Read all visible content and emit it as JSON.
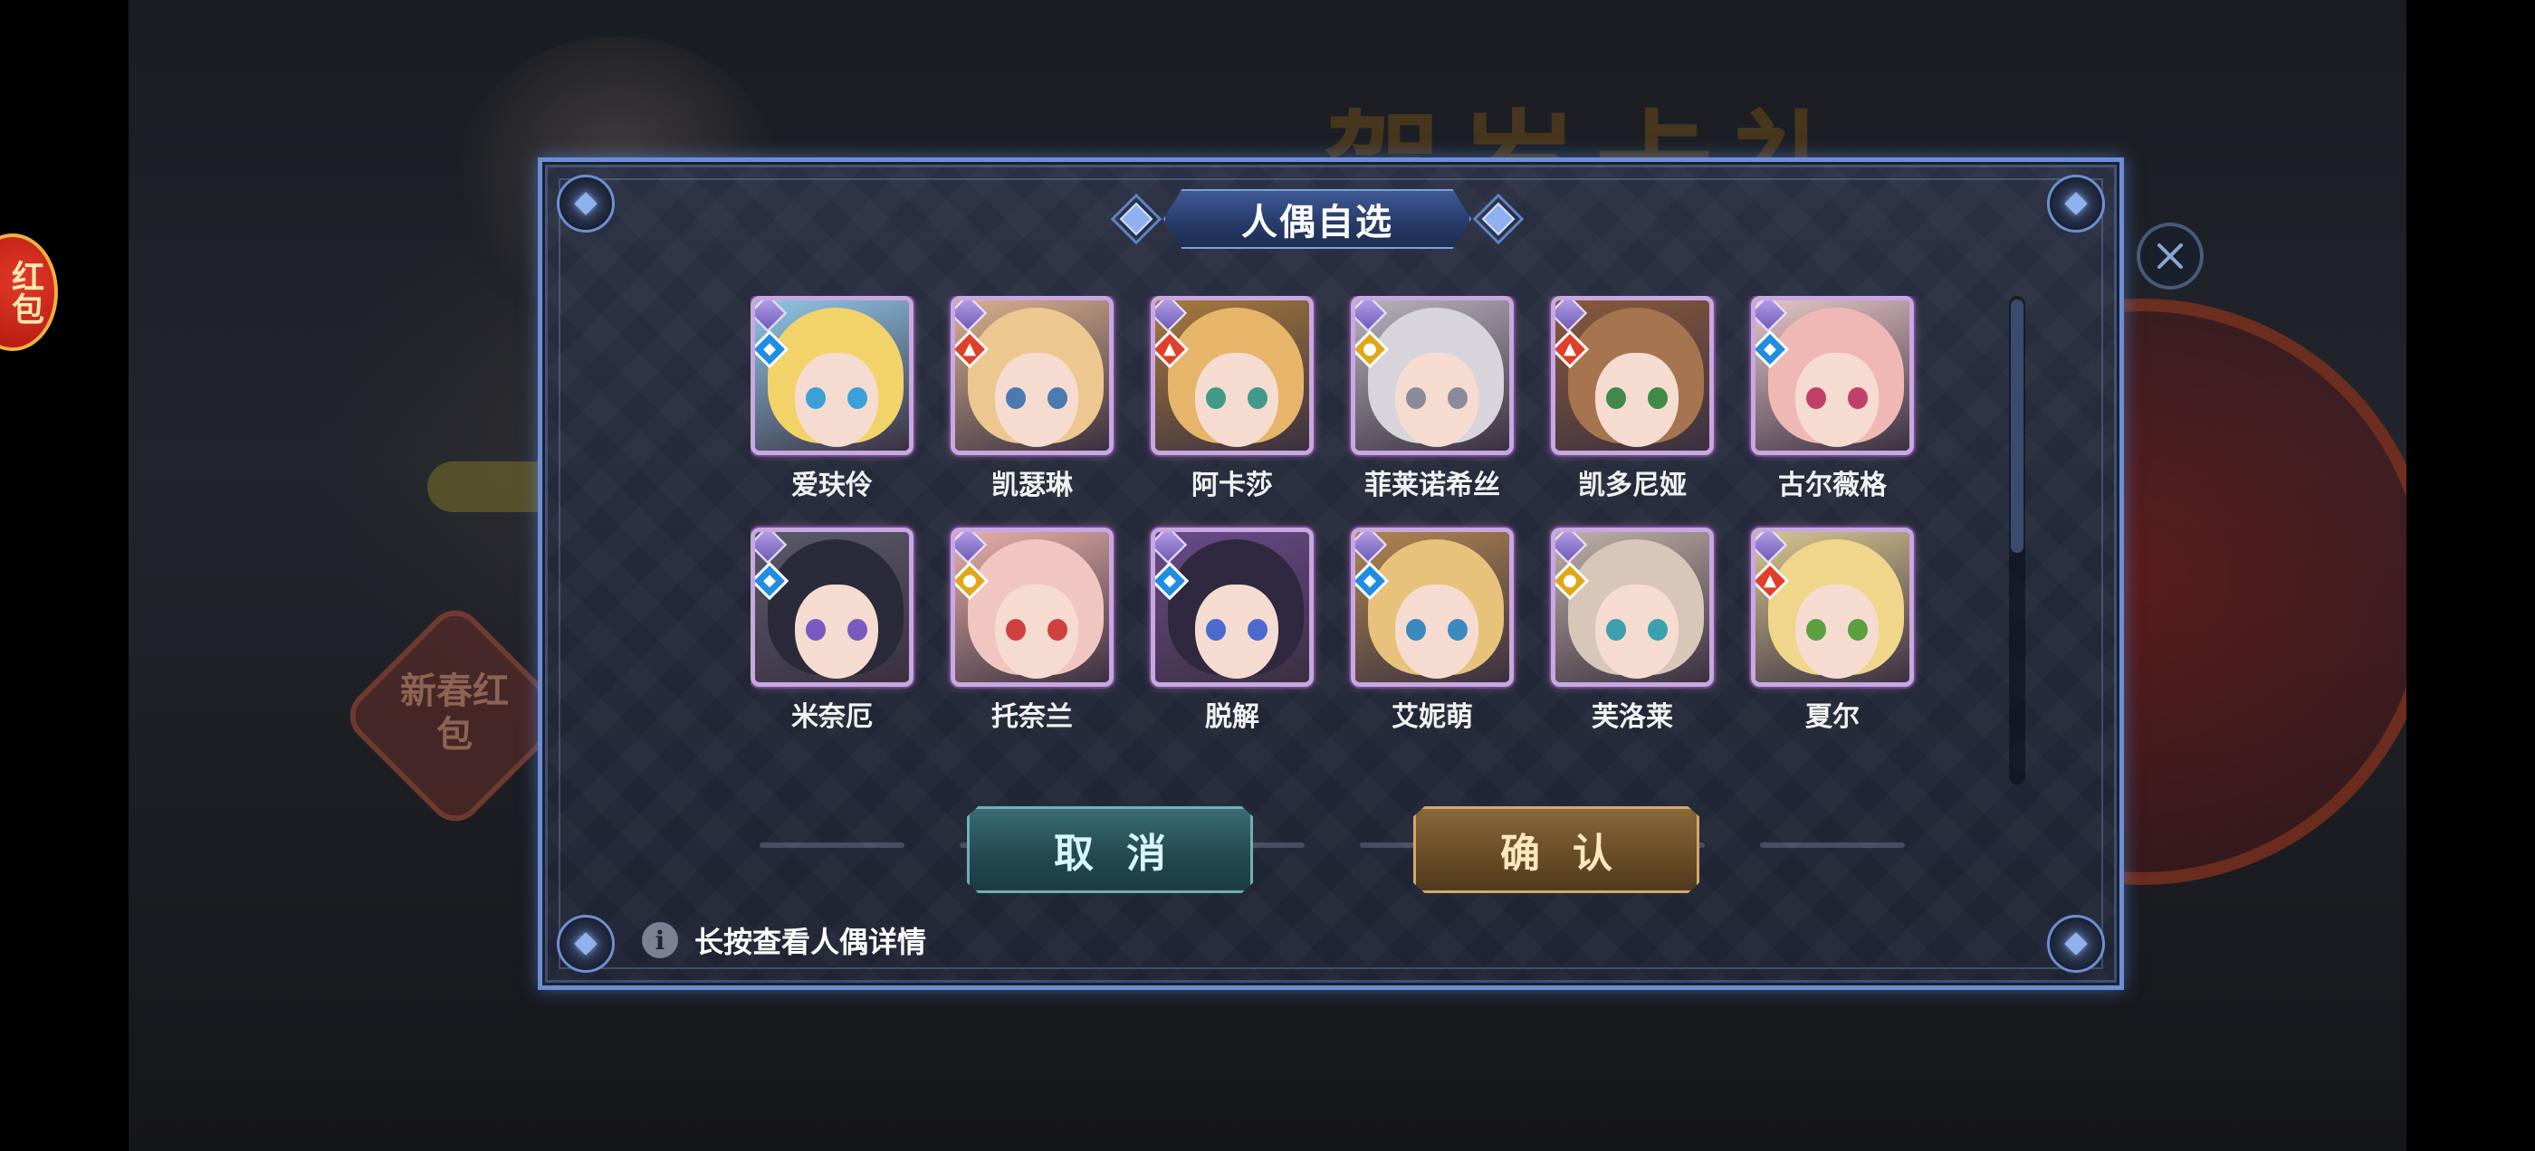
{
  "background": {
    "title_glyphs": "贺岁卡礼",
    "badge_text": "新春红包"
  },
  "red_packet": {
    "label": "红包"
  },
  "dialog": {
    "title": "人偶自选",
    "characters": [
      {
        "name": "爱玞伶",
        "element": "water",
        "hair": "#f2d36a",
        "eyes": "#3aa0d8",
        "bg": "#8fc8e8"
      },
      {
        "name": "凯瑟琳",
        "element": "fire",
        "hair": "#ecc890",
        "eyes": "#4a7ab0",
        "bg": "#d9b08e"
      },
      {
        "name": "阿卡莎",
        "element": "fire",
        "hair": "#e6b56a",
        "eyes": "#3f9a8a",
        "bg": "#a87a3c"
      },
      {
        "name": "菲莱诺希丝",
        "element": "light",
        "hair": "#d8d4dc",
        "eyes": "#8a8a9a",
        "bg": "#b9b3bc"
      },
      {
        "name": "凯多尼娅",
        "element": "fire",
        "hair": "#a77450",
        "eyes": "#3f8a4a",
        "bg": "#8a5a3c"
      },
      {
        "name": "古尔薇格",
        "element": "water",
        "hair": "#f0b8b4",
        "eyes": "#c0406a",
        "bg": "#e6c6c6"
      },
      {
        "name": "米奈厄",
        "element": "water",
        "hair": "#2a2a3a",
        "eyes": "#7a5ac0",
        "bg": "#5a5a6a"
      },
      {
        "name": "托奈兰",
        "element": "light",
        "hair": "#f2c6c0",
        "eyes": "#d04040",
        "bg": "#e8b0a8"
      },
      {
        "name": "脱解",
        "element": "water",
        "hair": "#2f2840",
        "eyes": "#4a6ad0",
        "bg": "#6a4a8a"
      },
      {
        "name": "艾妮萌",
        "element": "water",
        "hair": "#e6c27a",
        "eyes": "#3a8ac0",
        "bg": "#b08650"
      },
      {
        "name": "芙洛莱",
        "element": "light",
        "hair": "#d8c6b8",
        "eyes": "#3aa0b0",
        "bg": "#c0b0a6"
      },
      {
        "name": "夏尔",
        "element": "fire",
        "hair": "#f0d68a",
        "eyes": "#5aa040",
        "bg": "#d8c690"
      }
    ],
    "cancel_label": "取消",
    "confirm_label": "确认",
    "hint_text": "长按查看人偶详情",
    "info_icon_glyph": "i",
    "close_glyph": "✕"
  },
  "colors": {
    "frame_blue": "#6d8fd2",
    "cancel_teal": "#244a52",
    "confirm_bronze": "#6a4e28",
    "element_water": "#1f8de0",
    "element_fire": "#e0402a",
    "element_light": "#e0a818"
  },
  "icons": {
    "element_water": "water-drop-icon",
    "element_fire": "flame-icon",
    "element_light": "sun-icon",
    "class": "wing-class-icon"
  }
}
